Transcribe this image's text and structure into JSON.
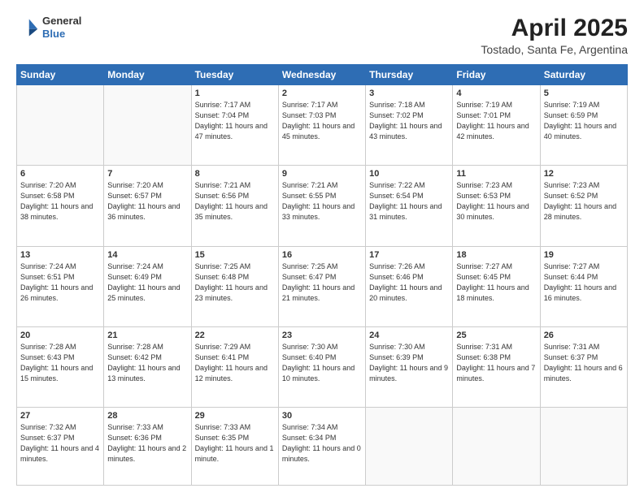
{
  "logo": {
    "line1": "General",
    "line2": "Blue"
  },
  "title": "April 2025",
  "subtitle": "Tostado, Santa Fe, Argentina",
  "headers": [
    "Sunday",
    "Monday",
    "Tuesday",
    "Wednesday",
    "Thursday",
    "Friday",
    "Saturday"
  ],
  "weeks": [
    [
      {
        "day": "",
        "sunrise": "",
        "sunset": "",
        "daylight": ""
      },
      {
        "day": "",
        "sunrise": "",
        "sunset": "",
        "daylight": ""
      },
      {
        "day": "1",
        "sunrise": "Sunrise: 7:17 AM",
        "sunset": "Sunset: 7:04 PM",
        "daylight": "Daylight: 11 hours and 47 minutes."
      },
      {
        "day": "2",
        "sunrise": "Sunrise: 7:17 AM",
        "sunset": "Sunset: 7:03 PM",
        "daylight": "Daylight: 11 hours and 45 minutes."
      },
      {
        "day": "3",
        "sunrise": "Sunrise: 7:18 AM",
        "sunset": "Sunset: 7:02 PM",
        "daylight": "Daylight: 11 hours and 43 minutes."
      },
      {
        "day": "4",
        "sunrise": "Sunrise: 7:19 AM",
        "sunset": "Sunset: 7:01 PM",
        "daylight": "Daylight: 11 hours and 42 minutes."
      },
      {
        "day": "5",
        "sunrise": "Sunrise: 7:19 AM",
        "sunset": "Sunset: 6:59 PM",
        "daylight": "Daylight: 11 hours and 40 minutes."
      }
    ],
    [
      {
        "day": "6",
        "sunrise": "Sunrise: 7:20 AM",
        "sunset": "Sunset: 6:58 PM",
        "daylight": "Daylight: 11 hours and 38 minutes."
      },
      {
        "day": "7",
        "sunrise": "Sunrise: 7:20 AM",
        "sunset": "Sunset: 6:57 PM",
        "daylight": "Daylight: 11 hours and 36 minutes."
      },
      {
        "day": "8",
        "sunrise": "Sunrise: 7:21 AM",
        "sunset": "Sunset: 6:56 PM",
        "daylight": "Daylight: 11 hours and 35 minutes."
      },
      {
        "day": "9",
        "sunrise": "Sunrise: 7:21 AM",
        "sunset": "Sunset: 6:55 PM",
        "daylight": "Daylight: 11 hours and 33 minutes."
      },
      {
        "day": "10",
        "sunrise": "Sunrise: 7:22 AM",
        "sunset": "Sunset: 6:54 PM",
        "daylight": "Daylight: 11 hours and 31 minutes."
      },
      {
        "day": "11",
        "sunrise": "Sunrise: 7:23 AM",
        "sunset": "Sunset: 6:53 PM",
        "daylight": "Daylight: 11 hours and 30 minutes."
      },
      {
        "day": "12",
        "sunrise": "Sunrise: 7:23 AM",
        "sunset": "Sunset: 6:52 PM",
        "daylight": "Daylight: 11 hours and 28 minutes."
      }
    ],
    [
      {
        "day": "13",
        "sunrise": "Sunrise: 7:24 AM",
        "sunset": "Sunset: 6:51 PM",
        "daylight": "Daylight: 11 hours and 26 minutes."
      },
      {
        "day": "14",
        "sunrise": "Sunrise: 7:24 AM",
        "sunset": "Sunset: 6:49 PM",
        "daylight": "Daylight: 11 hours and 25 minutes."
      },
      {
        "day": "15",
        "sunrise": "Sunrise: 7:25 AM",
        "sunset": "Sunset: 6:48 PM",
        "daylight": "Daylight: 11 hours and 23 minutes."
      },
      {
        "day": "16",
        "sunrise": "Sunrise: 7:25 AM",
        "sunset": "Sunset: 6:47 PM",
        "daylight": "Daylight: 11 hours and 21 minutes."
      },
      {
        "day": "17",
        "sunrise": "Sunrise: 7:26 AM",
        "sunset": "Sunset: 6:46 PM",
        "daylight": "Daylight: 11 hours and 20 minutes."
      },
      {
        "day": "18",
        "sunrise": "Sunrise: 7:27 AM",
        "sunset": "Sunset: 6:45 PM",
        "daylight": "Daylight: 11 hours and 18 minutes."
      },
      {
        "day": "19",
        "sunrise": "Sunrise: 7:27 AM",
        "sunset": "Sunset: 6:44 PM",
        "daylight": "Daylight: 11 hours and 16 minutes."
      }
    ],
    [
      {
        "day": "20",
        "sunrise": "Sunrise: 7:28 AM",
        "sunset": "Sunset: 6:43 PM",
        "daylight": "Daylight: 11 hours and 15 minutes."
      },
      {
        "day": "21",
        "sunrise": "Sunrise: 7:28 AM",
        "sunset": "Sunset: 6:42 PM",
        "daylight": "Daylight: 11 hours and 13 minutes."
      },
      {
        "day": "22",
        "sunrise": "Sunrise: 7:29 AM",
        "sunset": "Sunset: 6:41 PM",
        "daylight": "Daylight: 11 hours and 12 minutes."
      },
      {
        "day": "23",
        "sunrise": "Sunrise: 7:30 AM",
        "sunset": "Sunset: 6:40 PM",
        "daylight": "Daylight: 11 hours and 10 minutes."
      },
      {
        "day": "24",
        "sunrise": "Sunrise: 7:30 AM",
        "sunset": "Sunset: 6:39 PM",
        "daylight": "Daylight: 11 hours and 9 minutes."
      },
      {
        "day": "25",
        "sunrise": "Sunrise: 7:31 AM",
        "sunset": "Sunset: 6:38 PM",
        "daylight": "Daylight: 11 hours and 7 minutes."
      },
      {
        "day": "26",
        "sunrise": "Sunrise: 7:31 AM",
        "sunset": "Sunset: 6:37 PM",
        "daylight": "Daylight: 11 hours and 6 minutes."
      }
    ],
    [
      {
        "day": "27",
        "sunrise": "Sunrise: 7:32 AM",
        "sunset": "Sunset: 6:37 PM",
        "daylight": "Daylight: 11 hours and 4 minutes."
      },
      {
        "day": "28",
        "sunrise": "Sunrise: 7:33 AM",
        "sunset": "Sunset: 6:36 PM",
        "daylight": "Daylight: 11 hours and 2 minutes."
      },
      {
        "day": "29",
        "sunrise": "Sunrise: 7:33 AM",
        "sunset": "Sunset: 6:35 PM",
        "daylight": "Daylight: 11 hours and 1 minute."
      },
      {
        "day": "30",
        "sunrise": "Sunrise: 7:34 AM",
        "sunset": "Sunset: 6:34 PM",
        "daylight": "Daylight: 11 hours and 0 minutes."
      },
      {
        "day": "",
        "sunrise": "",
        "sunset": "",
        "daylight": ""
      },
      {
        "day": "",
        "sunrise": "",
        "sunset": "",
        "daylight": ""
      },
      {
        "day": "",
        "sunrise": "",
        "sunset": "",
        "daylight": ""
      }
    ]
  ]
}
